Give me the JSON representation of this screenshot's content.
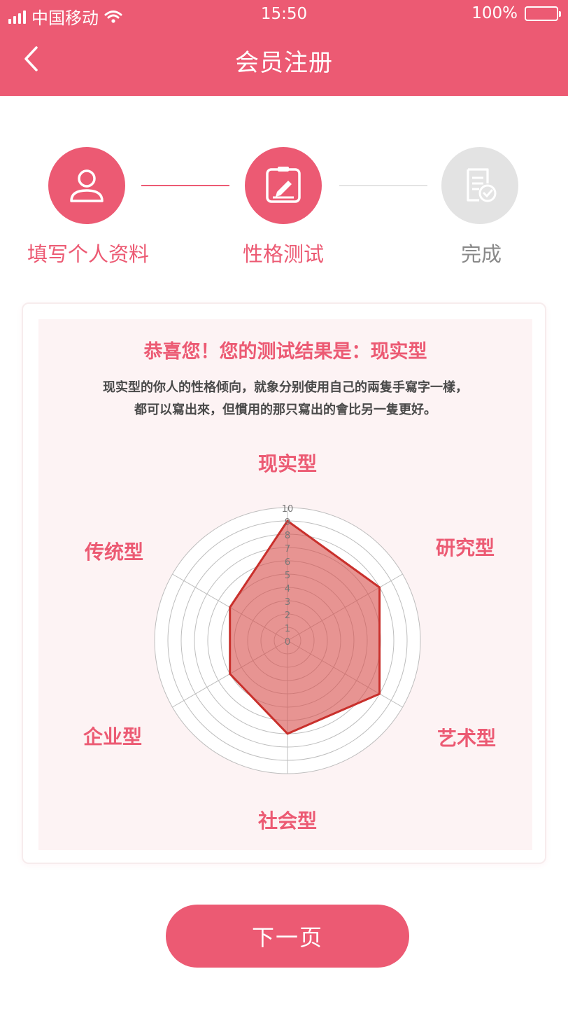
{
  "status_bar": {
    "carrier": "中国移动",
    "time": "15:50",
    "battery": "100%"
  },
  "nav": {
    "title": "会员注册",
    "back_icon": "chevron-left-icon"
  },
  "steps": [
    {
      "label": "填写个人资料",
      "icon": "user-icon",
      "state": "done"
    },
    {
      "label": "性格测试",
      "icon": "edit-clipboard-icon",
      "state": "current"
    },
    {
      "label": "完成",
      "icon": "document-check-icon",
      "state": "pending"
    }
  ],
  "result": {
    "title": "恭喜您！您的测试结果是：现实型",
    "desc_line1": "现实型的你人的性格倾向，就象分别使用自己的兩隻手寫字一樣，",
    "desc_line2": "都可以寫出來，但慣用的那只寫出的會比另一隻更好。"
  },
  "chart_data": {
    "type": "radar",
    "axes": [
      "现实型",
      "研究型",
      "艺术型",
      "社会型",
      "企业型",
      "传统型"
    ],
    "values": [
      9,
      8,
      8,
      7,
      5,
      5
    ],
    "r_max": 10,
    "r_ticks": [
      "0",
      "1",
      "2",
      "3",
      "4",
      "5",
      "6",
      "7",
      "8",
      "9",
      "10"
    ],
    "grid": true,
    "colors": {
      "fill": "#d9534f",
      "stroke": "#c9302c",
      "grid": "#bdbdbd"
    }
  },
  "next_button": {
    "label": "下一页"
  },
  "colors": {
    "accent": "#ec5a73",
    "inactive": "#e3e3e3",
    "inactive_text": "#8a8a8a"
  }
}
